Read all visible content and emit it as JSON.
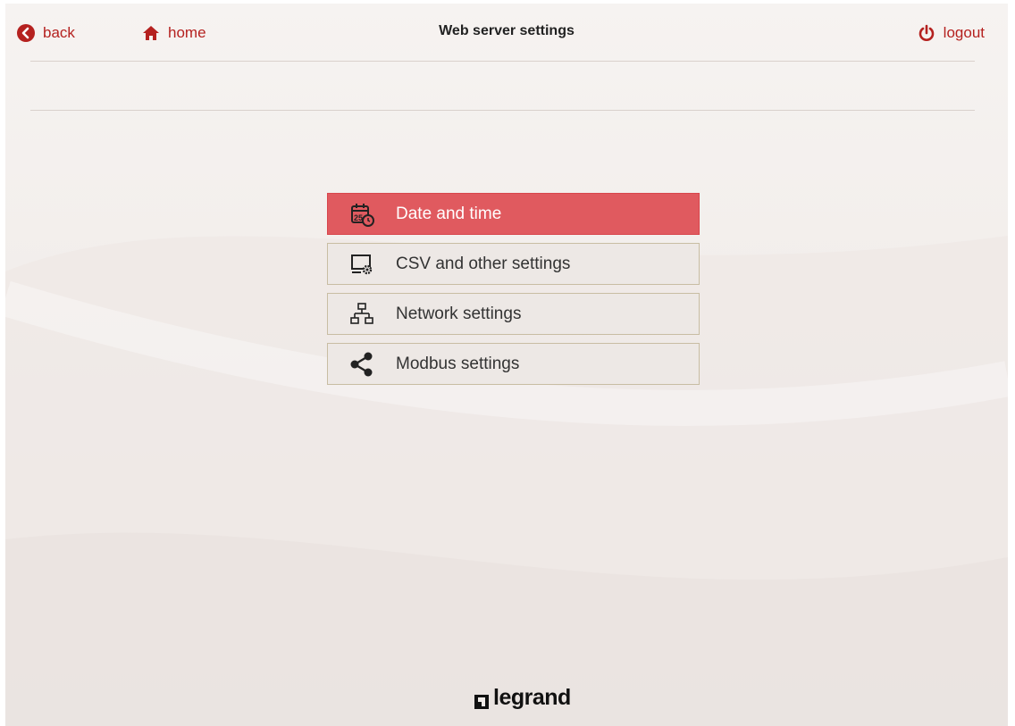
{
  "header": {
    "back_label": "back",
    "home_label": "home",
    "title": "Web server settings",
    "logout_label": "logout"
  },
  "menu": {
    "items": [
      {
        "label": "Date and time",
        "icon": "calendar-clock-icon",
        "active": true
      },
      {
        "label": "CSV and other settings",
        "icon": "monitor-gear-icon",
        "active": false
      },
      {
        "label": "Network settings",
        "icon": "network-icon",
        "active": false
      },
      {
        "label": "Modbus settings",
        "icon": "share-icon",
        "active": false
      }
    ]
  },
  "footer": {
    "brand": "legrand"
  },
  "colors": {
    "accent": "#b5211f",
    "active_item": "#e05a5f",
    "item_background": "#ede8e5",
    "item_border": "#c8bda3",
    "page_background": "#f3efec"
  }
}
